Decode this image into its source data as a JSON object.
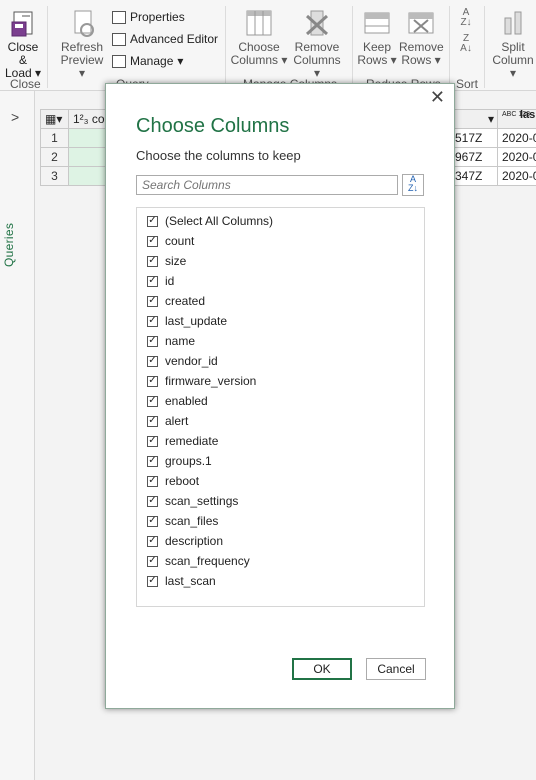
{
  "ribbon": {
    "close_group": {
      "label1": "Close &",
      "label2": "Load",
      "group": "Close"
    },
    "refresh": {
      "label1": "Refresh",
      "label2": "Preview"
    },
    "properties": "Properties",
    "advanced_editor": "Advanced Editor",
    "manage": "Manage",
    "query_group": "Query",
    "choose_columns": {
      "label1": "Choose",
      "label2": "Columns"
    },
    "remove_columns": {
      "label1": "Remove",
      "label2": "Columns"
    },
    "manage_columns_group": "Manage Columns",
    "keep_rows": {
      "label1": "Keep",
      "label2": "Rows"
    },
    "remove_rows": {
      "label1": "Remove",
      "label2": "Rows"
    },
    "reduce_rows_group": "Reduce Rows",
    "sort_group": "Sort",
    "split_column": {
      "label1": "Split",
      "label2": "Column"
    }
  },
  "queries_pane": {
    "label": "Queries"
  },
  "grid": {
    "col1_header": "co",
    "col1_type": "1²₃",
    "col_last_type": "ABC 123",
    "col_last_header": "las",
    "rows": [
      {
        "no": "1",
        "mid": "517Z",
        "last": "2020-0"
      },
      {
        "no": "2",
        "mid": "967Z",
        "last": "2020-0"
      },
      {
        "no": "3",
        "mid": "347Z",
        "last": "2020-0"
      }
    ]
  },
  "dialog": {
    "title": "Choose Columns",
    "subtitle": "Choose the columns to keep",
    "search_placeholder": "Search Columns",
    "columns": [
      "(Select All Columns)",
      "count",
      "size",
      "id",
      "created",
      "last_update",
      "name",
      "vendor_id",
      "firmware_version",
      "enabled",
      "alert",
      "remediate",
      "groups.1",
      "reboot",
      "scan_settings",
      "scan_files",
      "description",
      "scan_frequency",
      "last_scan"
    ],
    "ok_label": "OK",
    "cancel_label": "Cancel"
  },
  "colors": {
    "accent_green": "#217346",
    "selected_cell": "#def3e4"
  }
}
